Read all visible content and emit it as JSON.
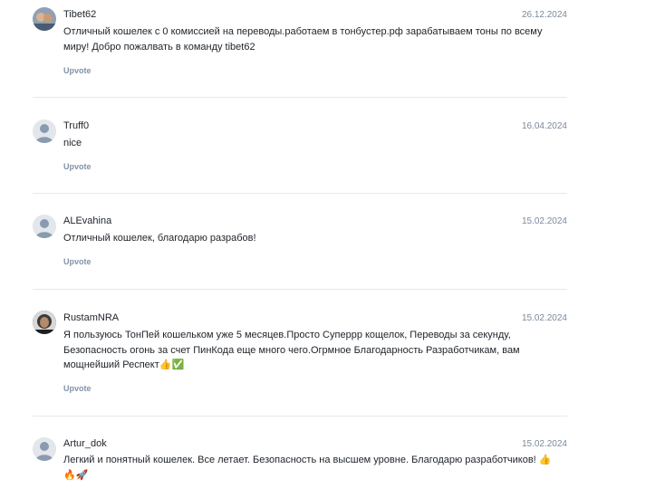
{
  "upvote_label": "Upvote",
  "comments": [
    {
      "username": "Tibet62",
      "date": "26.12.2024",
      "text": "Отличный кошелек с 0 комиссией на переводы.работаем в тонбустер.рф зарабатываем тоны по всему миру! Добро пожалвать в команду tibet62",
      "avatar": "user-photo"
    },
    {
      "username": "Truff0",
      "date": "16.04.2024",
      "text": "nice",
      "avatar": "default-user-icon"
    },
    {
      "username": "ALEvahina",
      "date": "15.02.2024",
      "text": "Отличный кошелек, благодарю разрабов!",
      "avatar": "default-user-icon"
    },
    {
      "username": "RustamNRA",
      "date": "15.02.2024",
      "text": "Я пользуюсь ТонПей кошельком уже 5 месяцев.Просто Суперрр кощелок, Переводы за секунду, Безопасность огонь за счет ПинКода еще много чего.Огрмное Благодарность Разработчикам, вам мощнейший Респект👍✅",
      "avatar": "user-photo"
    },
    {
      "username": "Artur_dok",
      "date": "15.02.2024",
      "text": "Легкий и понятный кошелек. Все летает. Безопасность на высшем уровне. Благодарю разработчиков! 👍🔥🚀",
      "avatar": "default-user-icon"
    }
  ]
}
